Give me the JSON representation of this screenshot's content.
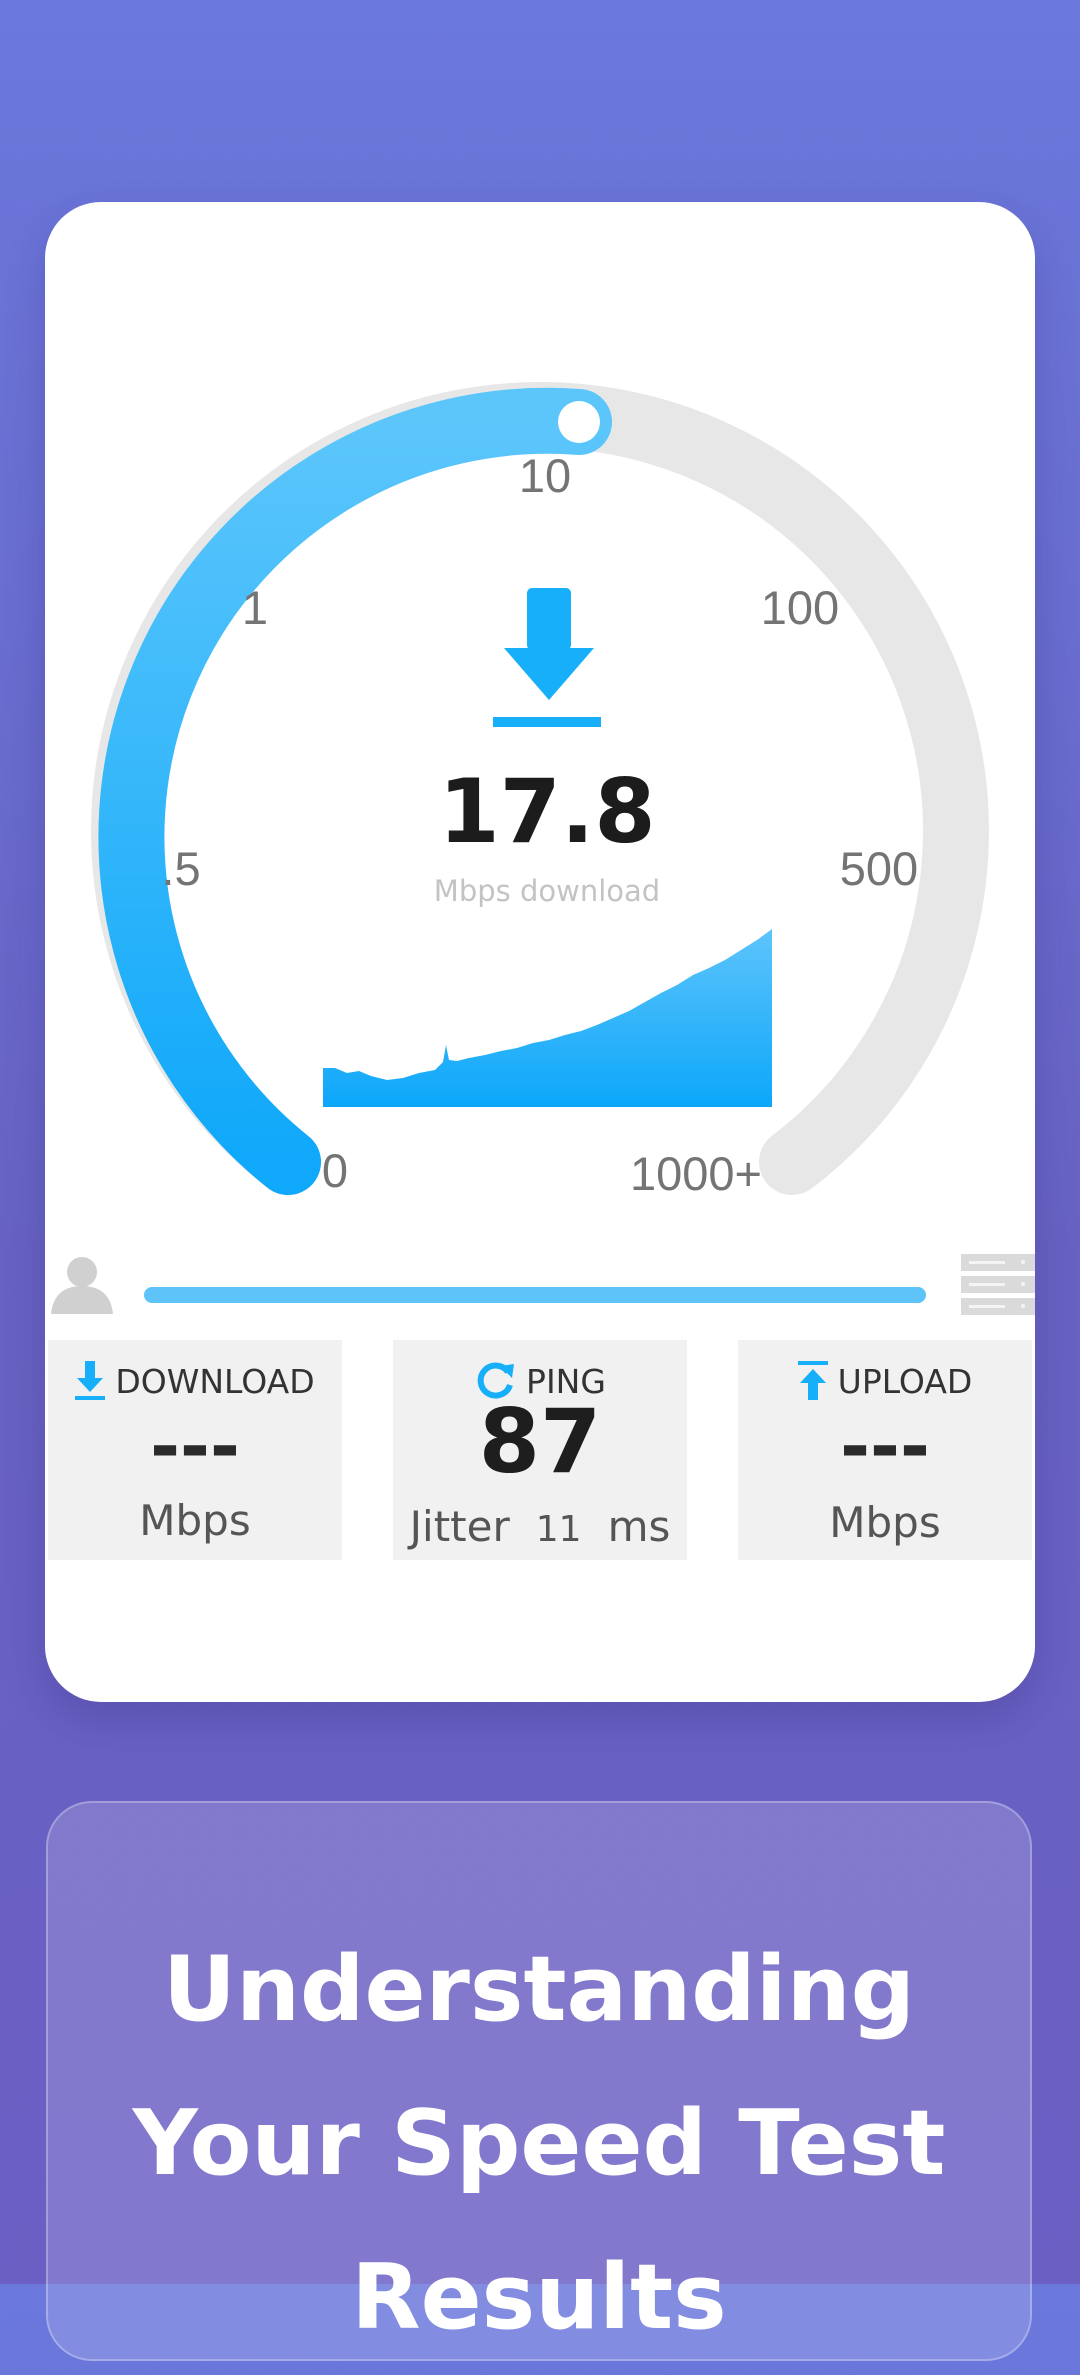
{
  "gauge": {
    "ticks": {
      "t0": "0",
      "t05": ".5",
      "t1": "1",
      "t10": "10",
      "t100": "100",
      "t500": "500",
      "t1000": "1000+"
    },
    "current_speed": "17.8",
    "unit_label": "Mbps download",
    "progress_fraction": 0.5,
    "accent_color": "#17aefa",
    "track_color": "#e7e7e7",
    "icon": "download-arrow-icon"
  },
  "test_progress": {
    "fraction": 1.0,
    "left_icon": "user-icon",
    "right_icon": "server-icon"
  },
  "stats": {
    "download": {
      "label": "DOWNLOAD",
      "value": "---",
      "unit": "Mbps",
      "icon": "download-icon"
    },
    "ping": {
      "label": "PING",
      "value": "87",
      "jitter_label": "Jitter",
      "jitter_value": "11",
      "unit": "ms",
      "icon": "refresh-icon"
    },
    "upload": {
      "label": "UPLOAD",
      "value": "---",
      "unit": "Mbps",
      "icon": "upload-icon"
    }
  },
  "info": {
    "title": "Understanding Your Speed Test Results"
  }
}
